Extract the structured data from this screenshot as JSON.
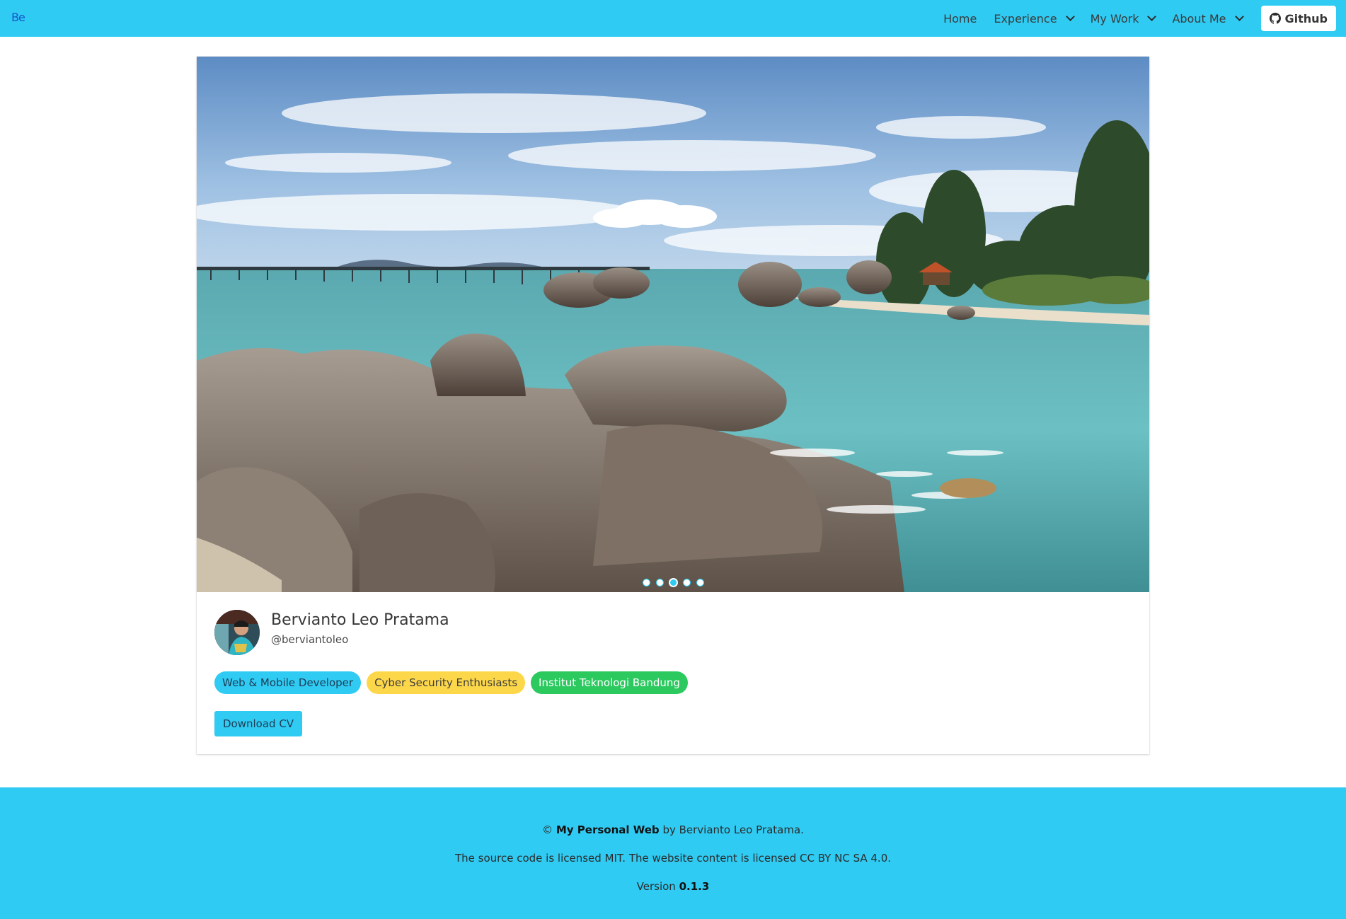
{
  "nav": {
    "brand": "Be",
    "items": [
      {
        "label": "Home"
      },
      {
        "label": "Experience"
      },
      {
        "label": "My Work"
      },
      {
        "label": "About Me"
      }
    ],
    "github_label": "Github"
  },
  "carousel": {
    "slide_count": 5,
    "active_index": 2
  },
  "profile": {
    "name": "Bervianto Leo Pratama",
    "handle": "@berviantoleo",
    "tags": [
      {
        "label": "Web & Mobile Developer",
        "color": "#2fcbf3"
      },
      {
        "label": "Cyber Security Enthusiasts",
        "color": "#fdd74a"
      },
      {
        "label": "Institut Teknologi Bandung",
        "color": "#2cc95f"
      }
    ],
    "download_label": "Download CV"
  },
  "footer": {
    "copyright_symbol": "©",
    "site_name": "My Personal Web",
    "by_text": "by Bervianto Leo Pratama.",
    "license_text": "The source code is licensed MIT. The website content is licensed CC BY NC SA 4.0.",
    "version_label": "Version",
    "version_value": "0.1.3"
  },
  "colors": {
    "primary": "#2fcbf3",
    "warning": "#fdd74a",
    "success": "#2cc95f"
  }
}
